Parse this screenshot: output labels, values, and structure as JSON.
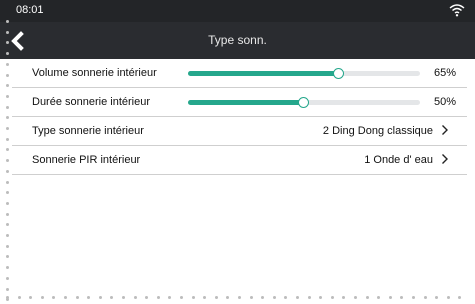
{
  "status_bar": {
    "time": "08:01",
    "wifi_icon": "wifi-icon"
  },
  "header": {
    "title": "Type sonn.",
    "back_icon": "chevron-left-icon"
  },
  "accent_color": "#25a78c",
  "settings": [
    {
      "label": "Volume sonnerie intérieur",
      "type": "slider",
      "value_percent": 65,
      "value_text": "65%"
    },
    {
      "label": "Durée sonnerie intérieur",
      "type": "slider",
      "value_percent": 50,
      "value_text": "50%"
    },
    {
      "label": "Type sonnerie intérieur",
      "type": "select",
      "value_text": "2 Ding Dong classique"
    },
    {
      "label": "Sonnerie PIR intérieur",
      "type": "select",
      "value_text": "1 Onde d' eau"
    }
  ]
}
